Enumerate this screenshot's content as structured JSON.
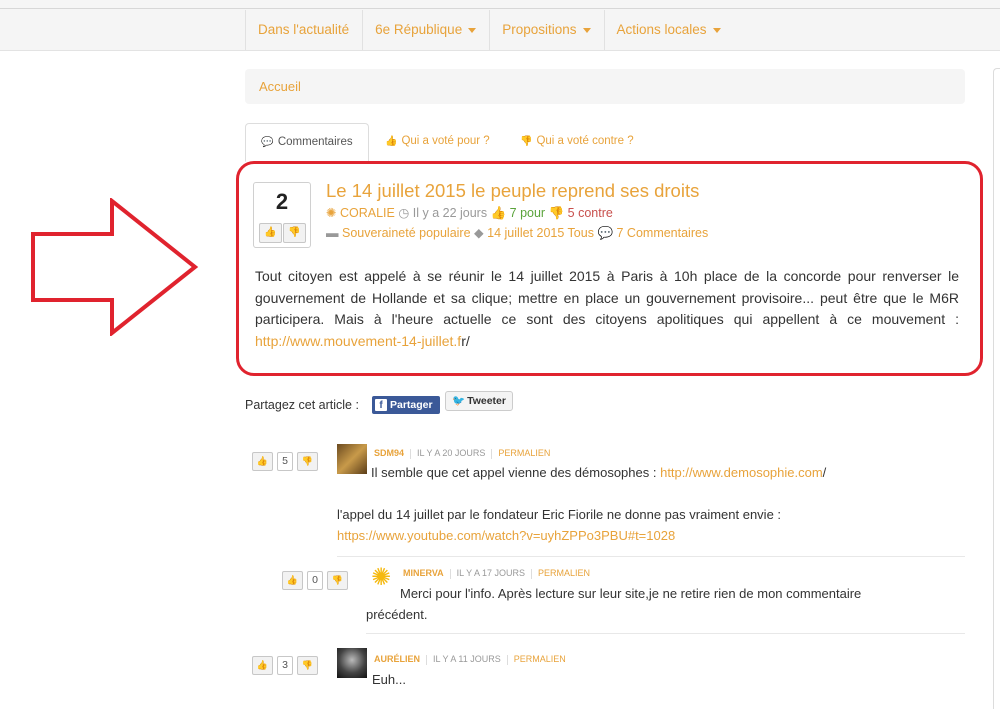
{
  "nav": {
    "items": [
      {
        "label": "Dans l'actualité",
        "has_menu": false
      },
      {
        "label": "6e République",
        "has_menu": true
      },
      {
        "label": "Propositions",
        "has_menu": true
      },
      {
        "label": "Actions locales",
        "has_menu": true
      }
    ]
  },
  "breadcrumb": {
    "home": "Accueil"
  },
  "tabs": {
    "comments": "Commentaires",
    "voted_for": "Qui a voté pour ?",
    "voted_against": "Qui a voté contre ?"
  },
  "post": {
    "score": "2",
    "title": "Le 14 juillet 2015 le peuple reprend ses droits",
    "author": "CORALIE",
    "time": "Il y a 22 jours",
    "votes_for": "7 pour",
    "votes_against": "5 contre",
    "category": "Souveraineté populaire",
    "tags": "14 juillet 2015 Tous",
    "comments_count": "7 Commentaires",
    "body": "Tout citoyen est appelé à se réunir le 14 juillet 2015 à Paris à 10h place de la concorde pour renverser le gouvernement de Hollande et sa clique; mettre en place un gouvernement provisoire... peut être que le M6R participera. Mais à l'heure actuelle ce sont des citoyens apolitiques qui appellent à ce mouvement :",
    "link_text": "http://www.mouvement-14-juillet.f",
    "link_tail": "r/"
  },
  "share": {
    "label": "Partagez cet article :",
    "facebook": "Partager",
    "twitter": "Tweeter"
  },
  "comments": [
    {
      "score": "5",
      "author": "SDM94",
      "time": "IL Y A 20 JOURS",
      "permalink": "PERMALIEN",
      "line1": "Il semble que cet appel vienne des démosophes :",
      "link1": "http://www.demosophie.com",
      "tail1": "/",
      "line2": "l'appel du 14 juillet par le fondateur Eric Fiorile ne donne pas vraiment envie :",
      "link2": "https://www.youtube.com/watch?v=uyhZPPo3PBU#t=1028"
    },
    {
      "score": "0",
      "author": "MINERVA",
      "time": "IL Y A 17 JOURS",
      "permalink": "PERMALIEN",
      "text": "Merci pour l'info. Après lecture sur leur site,je ne retire rien de mon commentaire précédent."
    },
    {
      "score": "3",
      "author": "AURÉLIEN",
      "time": "IL Y A 11 JOURS",
      "permalink": "PERMALIEN",
      "text": "Euh..."
    }
  ],
  "colors": {
    "accent": "#e8a33b",
    "highlight_border": "#e0232e",
    "vote_for": "#5aa33b",
    "vote_against": "#c8504d",
    "facebook": "#3b5998"
  }
}
